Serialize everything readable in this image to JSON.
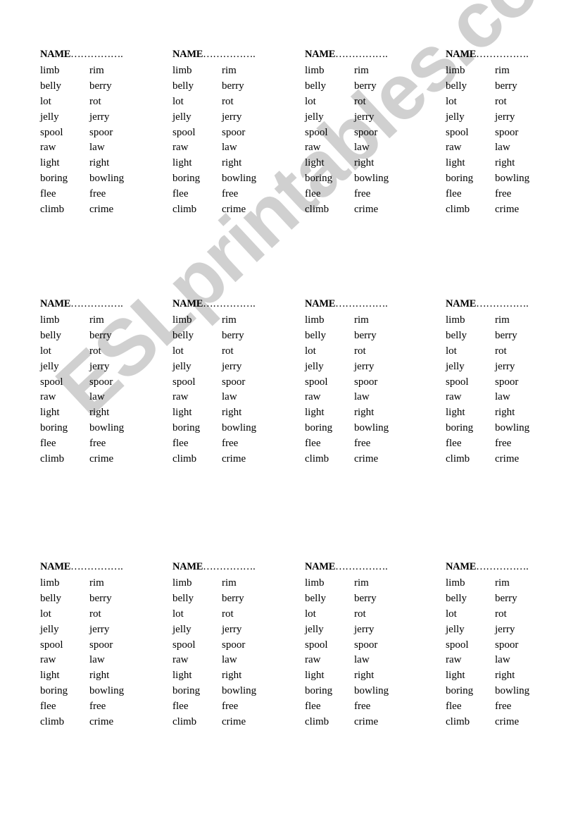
{
  "watermark": "ESLprintables.com",
  "card": {
    "name_label": "NAME",
    "name_dots": "…………….",
    "pairs": [
      [
        "limb",
        "rim"
      ],
      [
        "belly",
        "berry"
      ],
      [
        "lot",
        "rot"
      ],
      [
        "jelly",
        "jerry"
      ],
      [
        "spool",
        "spoor"
      ],
      [
        "raw",
        "law"
      ],
      [
        "light",
        "right"
      ],
      [
        "boring",
        "bowling"
      ],
      [
        "flee",
        "free"
      ],
      [
        "climb",
        "crime"
      ]
    ]
  },
  "grid": {
    "rows": 3,
    "columns": 4
  }
}
